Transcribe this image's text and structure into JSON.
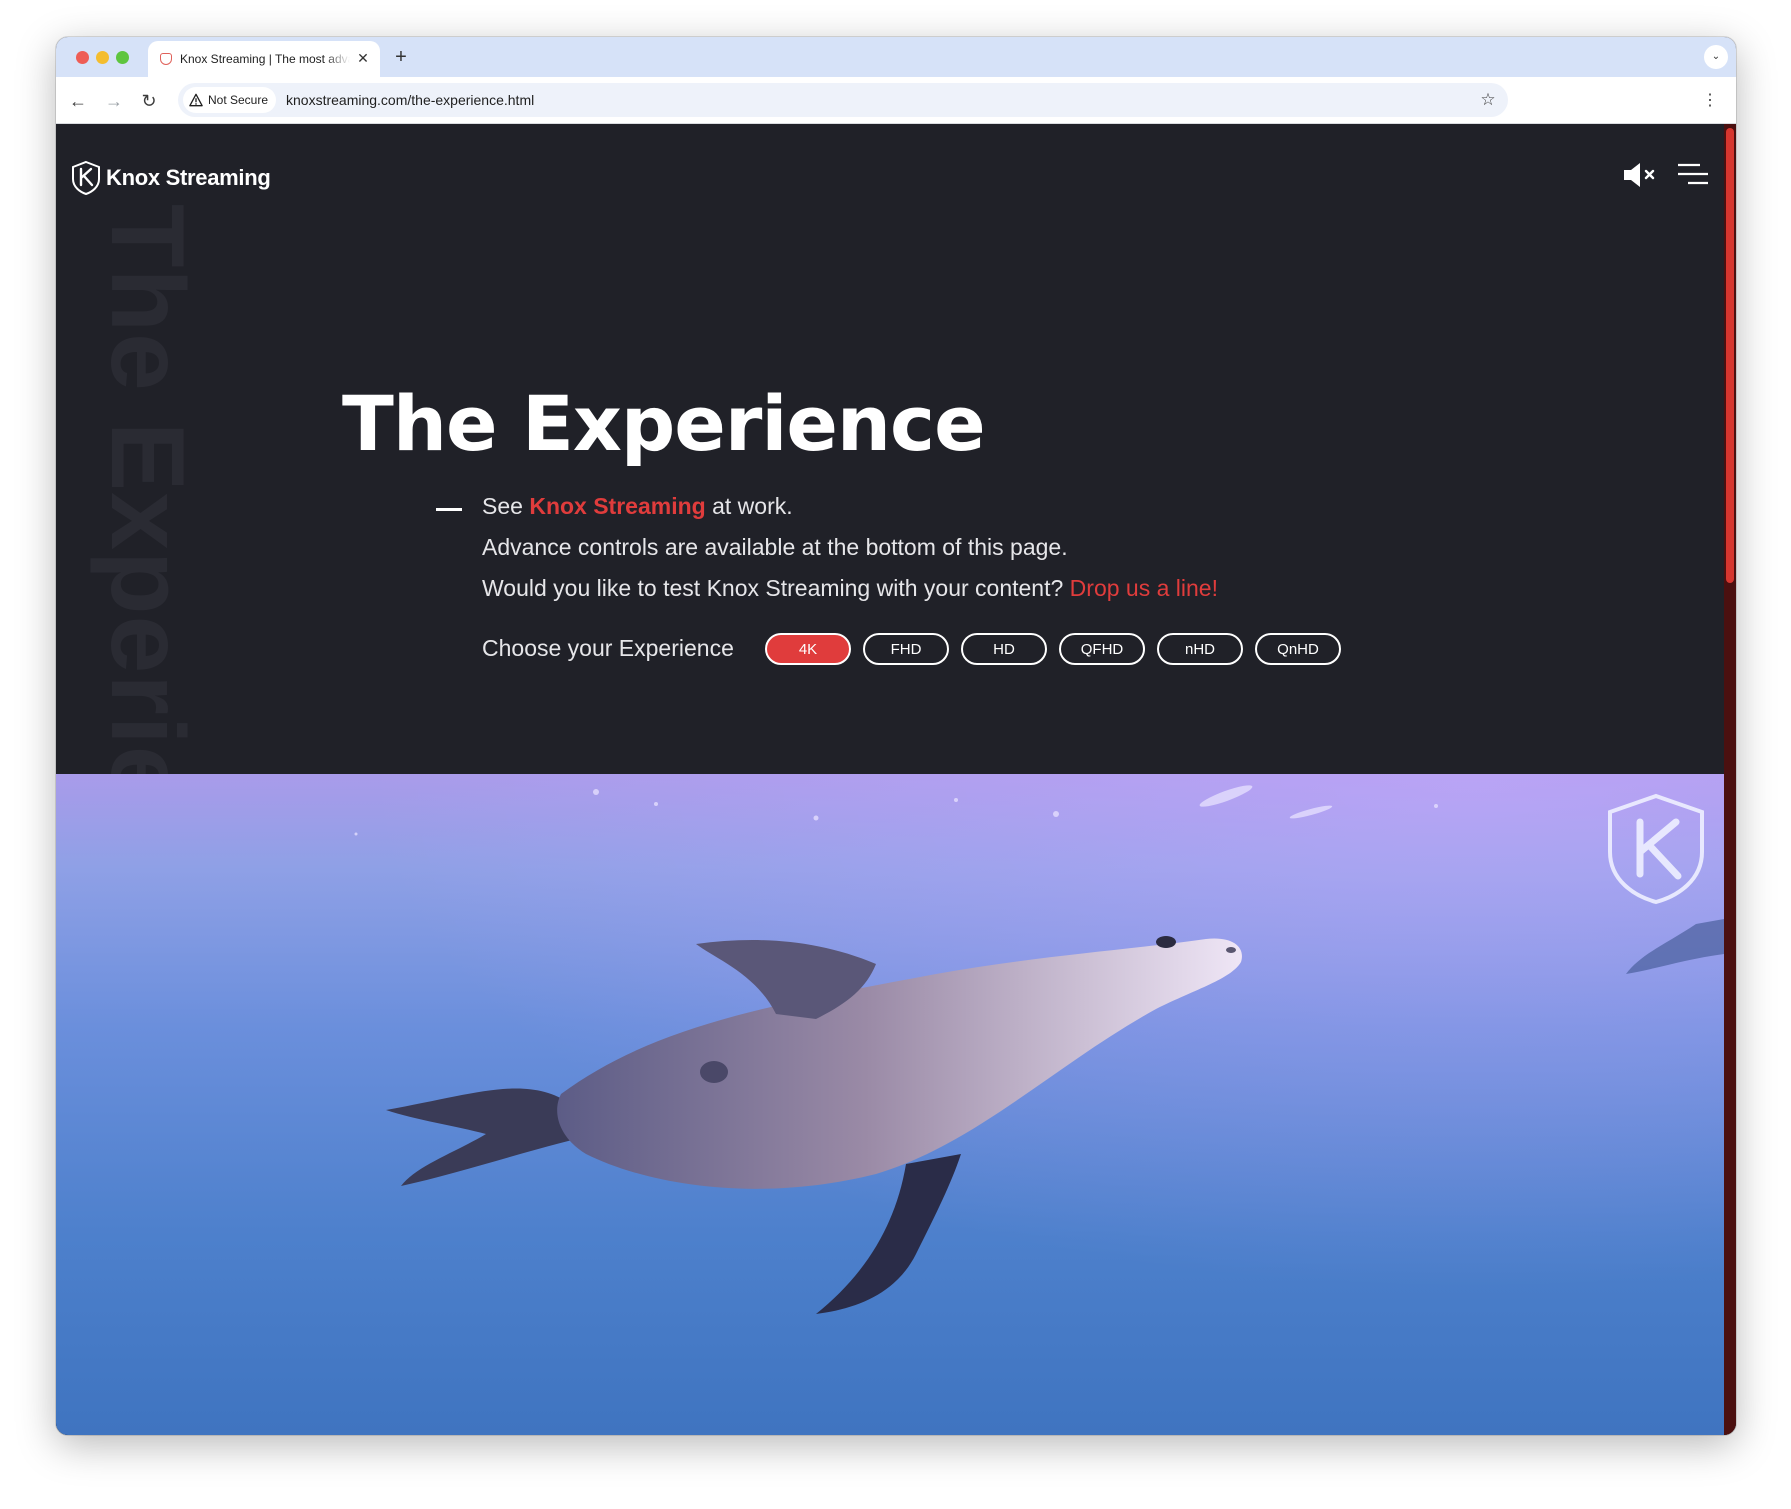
{
  "browser": {
    "tab_title": "Knox Streaming | The most advanced streaming",
    "tab_close": "✕",
    "new_tab": "+",
    "tab_menu": "⌄",
    "nav_back": "←",
    "nav_forward": "→",
    "nav_reload": "↻",
    "security_label": "Not Secure",
    "url": "knoxstreaming.com/the-experience.html",
    "bookmark": "☆",
    "menu": "⋮"
  },
  "site": {
    "brand": "Knox Streaming",
    "watermark": "The Experience",
    "accent_color": "#e03c3c",
    "background_color": "#202128"
  },
  "hero": {
    "title": "The Experience",
    "line1_prefix": "See ",
    "line1_brand": "Knox Streaming",
    "line1_suffix": " at work.",
    "line2": "Advance controls are available at the bottom of this page.",
    "line3_text": "Would you like to test Knox Streaming with your content? ",
    "line3_link": "Drop us a line!"
  },
  "quality": {
    "label": "Choose your Experience",
    "options": [
      "4K",
      "FHD",
      "HD",
      "QFHD",
      "nHD",
      "QnHD"
    ],
    "selected": "4K"
  }
}
